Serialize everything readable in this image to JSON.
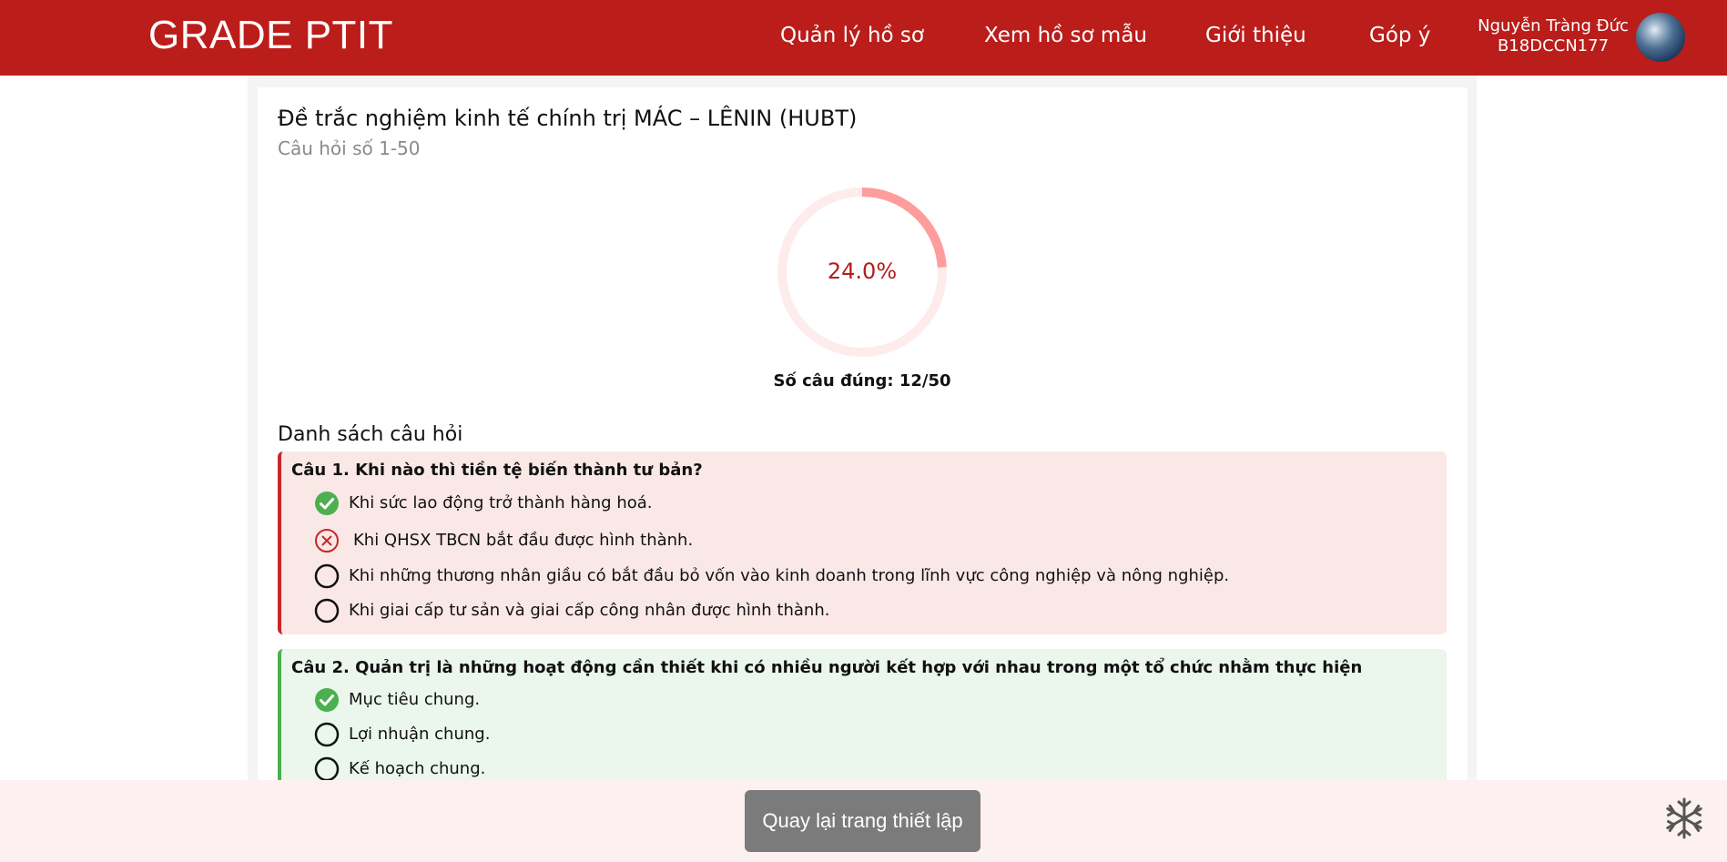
{
  "header": {
    "brand": "GRADE PTIT",
    "nav": [
      "Quản lý hồ sơ",
      "Xem hồ sơ mẫu",
      "Giới thiệu",
      "Góp ý"
    ],
    "user_name": "Nguyễn Tràng Đức",
    "user_id": "B18DCCN177"
  },
  "quiz": {
    "title": "Đề trắc nghiệm kinh tế chính trị MÁC – LÊNIN (HUBT)",
    "subtitle": "Câu hỏi số 1-50",
    "percent_text": "24.0%",
    "progress": 0.24,
    "score_text": "Số câu đúng: 12/50",
    "colors": {
      "progress": "#ff9c9c",
      "track": "#fdeceb",
      "wrong": "#c62828",
      "correct": "#4caf50"
    }
  },
  "questions_title": "Danh sách câu hỏi",
  "questions": [
    {
      "title": "Câu 1. Khi nào thì tiền tệ biến thành tư bản?",
      "status": "wrong",
      "options": [
        {
          "text": "Khi sức lao động trở thành hàng hoá.",
          "state": "correct-icon"
        },
        {
          "text": "Khi QHSX TBCN bắt đầu được hình thành.",
          "state": "wrong-icon"
        },
        {
          "text": "Khi những thương nhân giầu có bắt đầu bỏ vốn vào kinh doanh trong lĩnh vực công nghiệp và nông nghiệp.",
          "state": "empty-circle-icon"
        },
        {
          "text": "Khi giai cấp tư sản và giai cấp công nhân được hình thành.",
          "state": "empty-circle-icon"
        }
      ]
    },
    {
      "title": "Câu 2. Quản trị là những hoạt động cần thiết khi có nhiều người kết hợp với nhau trong một tổ chức nhằm thực hiện",
      "status": "right",
      "options": [
        {
          "text": "Mục tiêu chung.",
          "state": "correct-icon"
        },
        {
          "text": "Lợi nhuận chung.",
          "state": "empty-circle-icon"
        },
        {
          "text": "Kế hoạch chung.",
          "state": "empty-circle-icon"
        }
      ]
    }
  ],
  "footer": {
    "back_button": "Quay lại trang thiết lập",
    "icon": "snowflake-icon"
  }
}
